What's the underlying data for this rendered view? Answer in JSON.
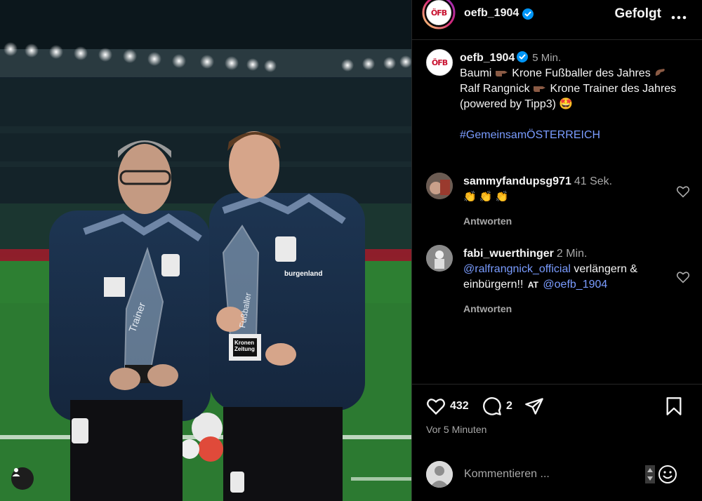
{
  "post": {
    "username": "oefb_1904",
    "logo_text": "ÖFB",
    "follow_state": "Gefolgt",
    "more_label": "•••",
    "caption_time": "5 Min.",
    "caption_line1": "Baumi",
    "caption_line1b": "Krone Fußballer des Jahres",
    "caption_line2": "Ralf Rangnick",
    "caption_line2b": "Krone Trainer des Jahres (powered by Tipp3)",
    "caption_emoji_end": "🤩",
    "hashtag": "#GemeinsamÖSTERREICH"
  },
  "comments": [
    {
      "user": "sammyfandupsg971",
      "time": "41 Sek.",
      "text": "👏 👏 👏",
      "reply_label": "Antworten"
    },
    {
      "user": "fabi_wuerthinger",
      "time": "2 Min.",
      "mention1": "@ralfrangnick_official",
      "text_mid": "verlängern & einbürgern!!",
      "at_label": "AT",
      "mention2": "@oefb_1904",
      "reply_label": "Antworten"
    }
  ],
  "actions": {
    "likes": "432",
    "comments": "2",
    "post_time": "Vor 5 Minuten"
  },
  "comment_box": {
    "placeholder": "Kommentieren ..."
  },
  "photo": {
    "trophy_left_label": "Trainer",
    "trophy_right_label": "Fußballer",
    "sponsor": "burgenland",
    "krone": "Kronen Zeitung"
  },
  "colors": {
    "background": "#000000",
    "link": "#7a9cff",
    "muted": "#a8a8a8",
    "verified": "#0095f6",
    "brand_red": "#c8102e"
  }
}
